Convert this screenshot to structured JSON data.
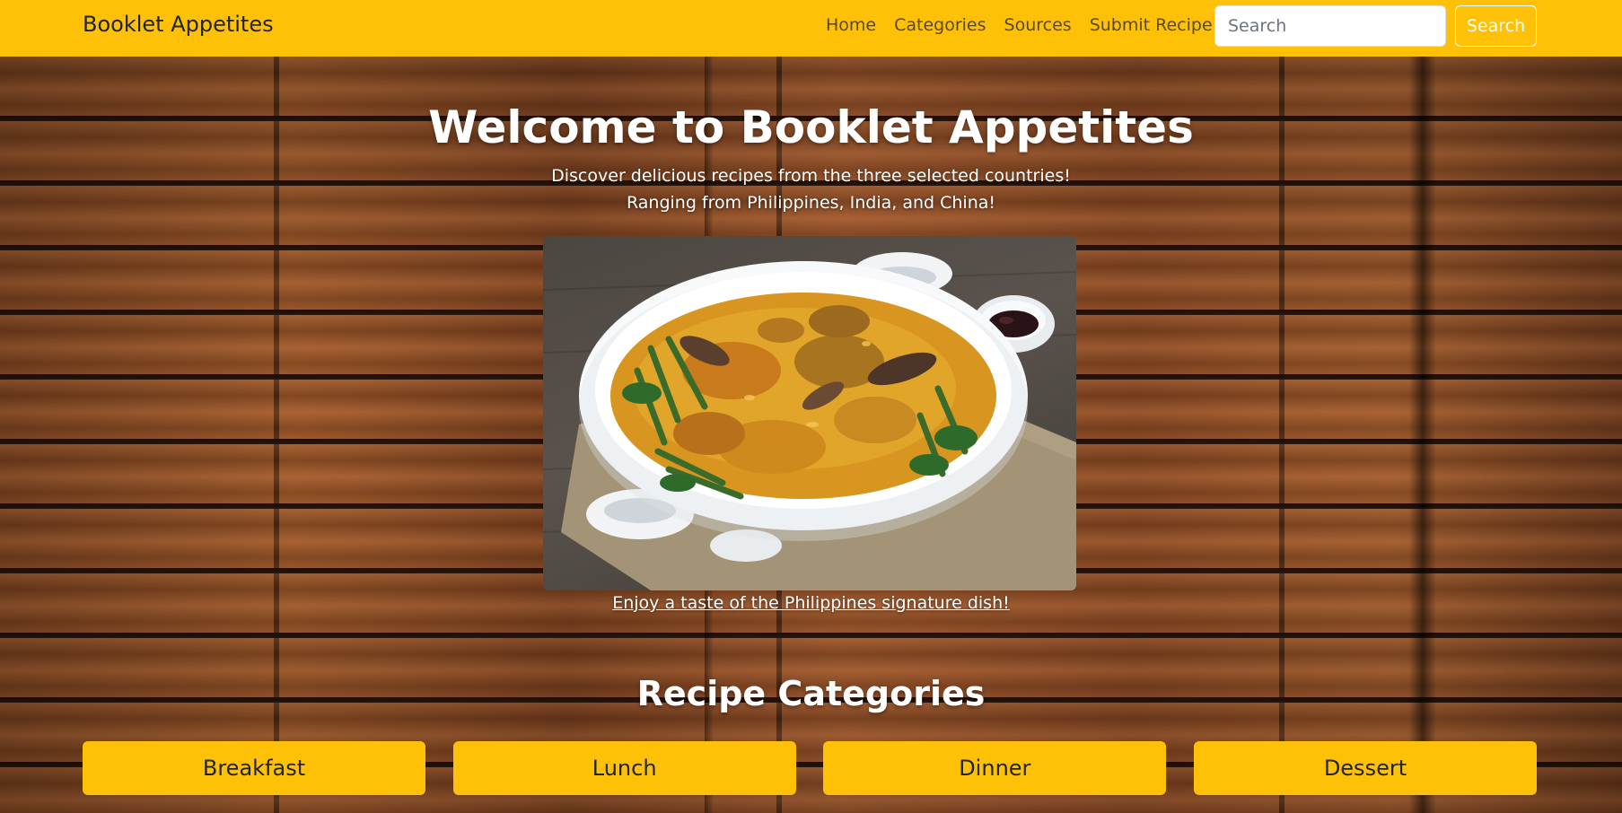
{
  "navbar": {
    "brand": "Booklet Appetites",
    "links": [
      {
        "label": "Home"
      },
      {
        "label": "Categories"
      },
      {
        "label": "Sources"
      },
      {
        "label": "Submit Recipe"
      }
    ],
    "search_placeholder": "Search",
    "search_button_label": "Search"
  },
  "hero": {
    "title": "Welcome to Booklet Appetites",
    "subtitle_line1": "Discover delicious recipes from the three selected countries!",
    "subtitle_line2": "Ranging from Philippines, India, and China!",
    "featured_caption": "Enjoy a taste of the Philippines signature dish!"
  },
  "categories": {
    "title": "Recipe Categories",
    "items": [
      {
        "label": "Breakfast"
      },
      {
        "label": "Lunch"
      },
      {
        "label": "Dinner"
      },
      {
        "label": "Dessert"
      }
    ]
  },
  "colors": {
    "navbar_bg": "#ffc107",
    "category_bg": "#ffc107",
    "text_dark": "#212529",
    "text_light": "#ffffff"
  }
}
